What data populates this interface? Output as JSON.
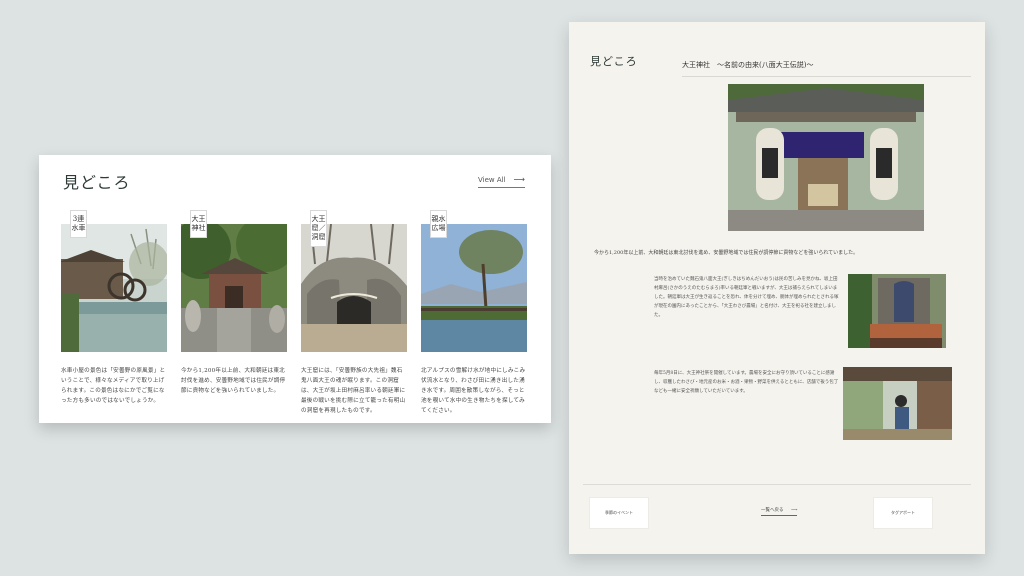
{
  "card": {
    "title": "見どころ",
    "view_all": "View All",
    "arrow": "⟶",
    "spots": [
      {
        "label": "3連水車",
        "desc": "水車小屋の景色は「安曇野の原風景」ということで、様々なメディアで取り上げられます。この景色はなにかでご覧になった方も多いのではないでしょうか。"
      },
      {
        "label": "大王神社",
        "desc": "今から1,200年以上前、大和朝廷は東北討伐を進め、安曇野地域では住民が調停節に貢物などを強いられていました。"
      },
      {
        "label": "大王窟／洞窟",
        "desc": "大王窟には、「安曇野族の大先祖」魏石鬼八面大王の魂が眠ります。この洞窟は、大王が坂上田村麻呂率いる朝廷軍に最後の戦いを挑む際に立て籠った有明山の洞窟を再現したものです。"
      },
      {
        "label": "親水広場",
        "desc": "北アルプスの雪解け水が地中にしみこみ伏流水となり、わさび田に湧き出した湧き水です。周囲を散策しながら、そっと池を覗いて水中の生き物たちを探してみてください。"
      }
    ]
  },
  "doc": {
    "title": "見どころ",
    "subtitle": "大王神社　〜名前の由来(八面大王伝説)〜",
    "intro": "今から1,200年以上前、大和朝廷は東北討伐を進め、安曇野地域では住民が調停節に貢物などを強いられていました。",
    "para1": "当時を治めていた魏石鬼八面大王(ぎしきはちめんだいおう)は民の苦しみを見かね、坂上田村麻呂(さかのうえのたむらまろ)率いる朝廷軍と戦いますが、大王は捕らえられてしまいました。朝廷軍は大王が生き返ることを恐れ、体を分けて埋め、胴体が埋められたとされる塚が現在の園内にあったことから、「大王わさび農場」と名付け、大王を祀る社を建立しました。",
    "para2": "毎年5月8日に、大王神社祭を開催しています。農場を安全にお守り頂いていることに感謝し、収穫したわさび・地元産のお米・お酒・果物・野菜を供えるとともに、店舗で祓う包丁なども一緒に安全祈願していただいています。",
    "btn_left": "季節のイベント",
    "btn_right": "タグアポート",
    "back": "一覧へ戻る",
    "back_arrow": "⟶"
  },
  "colors": {
    "background": "#dde3e3",
    "card": "#ffffff",
    "doc": "#f4f3ee",
    "title": "#2e3a36"
  }
}
